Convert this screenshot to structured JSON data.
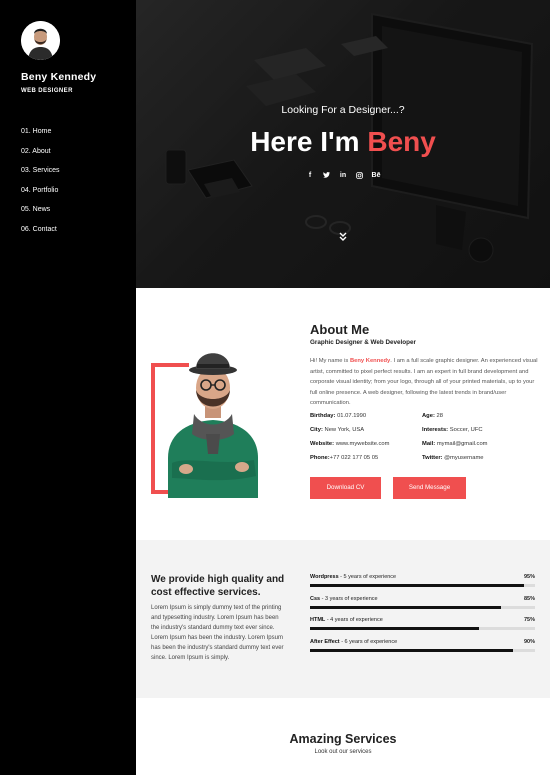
{
  "sidebar": {
    "name": "Beny Kennedy",
    "role": "WEB DESIGNER",
    "nav": [
      "01. Home",
      "02. About",
      "03. Services",
      "04. Portfolio",
      "05. News",
      "06. Contact"
    ]
  },
  "hero": {
    "tagline": "Looking For a Designer...?",
    "title_prefix": "Here I'm",
    "title_accent": "Beny",
    "socials": [
      "f",
      "t",
      "in",
      "ig",
      "Bē"
    ]
  },
  "about": {
    "title": "About Me",
    "subtitle": "Graphic Designer & Web Developer",
    "bio_intro": "Hi! My name is",
    "bio_name": "Beny Kennedy",
    "bio_rest": ". I am a full scale graphic designer. An experienced visual artist, committed to pixel perfect results. I am an expert in full brand development and corporate visual identity; from your logo, through all of your printed materials, up to your full online presence. A web designer, following the latest trends in brand/user communication.",
    "facts": [
      {
        "label": "Birthday:",
        "value": "01.07.1990"
      },
      {
        "label": "Age:",
        "value": "28"
      },
      {
        "label": "City:",
        "value": "New York, USA"
      },
      {
        "label": "Interests:",
        "value": "Soccer, UFC"
      },
      {
        "label": "Website:",
        "value": "www.mywebsite.com"
      },
      {
        "label": "Mail:",
        "value": "mymail@gmail.com"
      },
      {
        "label": "Phone:",
        "value": "+77 022 177 05 05"
      },
      {
        "label": "Twitter:",
        "value": "@myusername"
      }
    ],
    "buttons": {
      "download": "Download CV",
      "send": "Send Message"
    }
  },
  "skills": {
    "heading": "We provide high quality and cost effective services.",
    "description": "Lorem Ipsum is simply dummy text of the printing and typesetting industry. Lorem Ipsum has been the industry's standard dummy text ever since. Lorem Ipsum has been the industry. Lorem Ipsum has been the industry's standard dummy text ever since. Lorem Ipsum is simply.",
    "items": [
      {
        "name": "Wordpress",
        "years": "- 5 years of experience",
        "percent": "95%",
        "level": 0.95
      },
      {
        "name": "Css",
        "years": "- 3 years of experience",
        "percent": "85%",
        "level": 0.85
      },
      {
        "name": "HTML",
        "years": "- 4 years of experience",
        "percent": "75%",
        "level": 0.75
      },
      {
        "name": "After Effect",
        "years": "- 6 years of experience",
        "percent": "90%",
        "level": 0.9
      }
    ]
  },
  "services": {
    "title": "Amazing Services",
    "subtitle": "Look out our services"
  },
  "colors": {
    "accent": "#f04f4f",
    "sidebar": "#000000",
    "skills_bg": "#f3f3f3"
  }
}
